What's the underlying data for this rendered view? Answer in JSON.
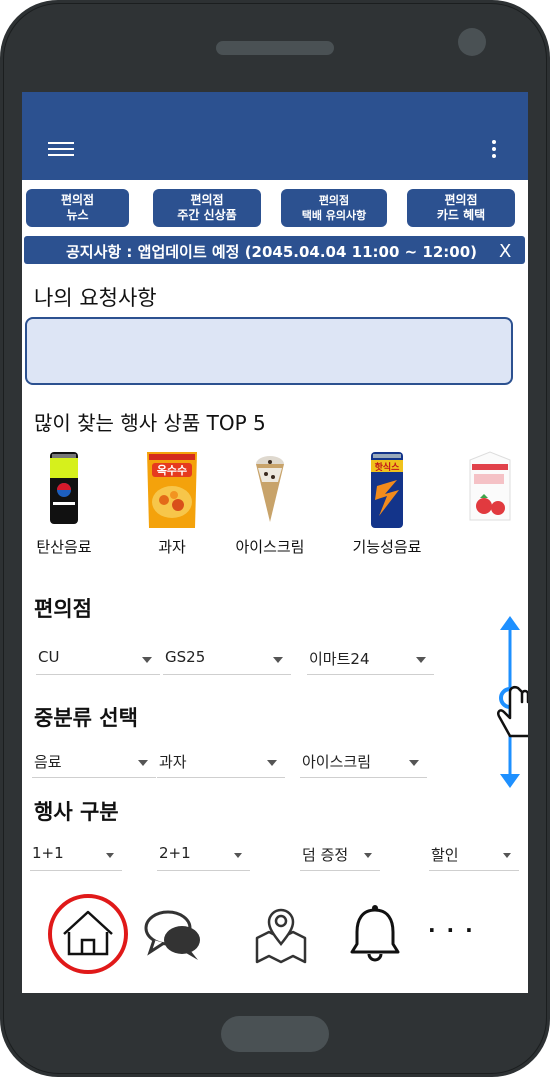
{
  "tabs": [
    {
      "line1": "편의점",
      "line2": "뉴스"
    },
    {
      "line1": "편의점",
      "line2": "주간 신상품"
    },
    {
      "line1": "편의점",
      "line2": "택배 유의사항"
    },
    {
      "line1": "편의점",
      "line2": "카드 혜택"
    }
  ],
  "notice": {
    "text": "공지사항 : 앱업데이트 예정 (2045.04.04 11:00 ~ 12:00)",
    "close": "X"
  },
  "request": {
    "title": "나의 요청사항",
    "value": ""
  },
  "top5": {
    "title": "많이 찾는 행사 상품 TOP 5",
    "items": [
      {
        "label": "탄산음료",
        "icon": "cola-can-icon"
      },
      {
        "label": "과자",
        "icon": "snack-bag-icon"
      },
      {
        "label": "아이스크림",
        "icon": "ice-cream-cone-icon"
      },
      {
        "label": "기능성음료",
        "icon": "energy-drink-can-icon"
      },
      {
        "label": "",
        "icon": "milk-carton-icon"
      }
    ]
  },
  "store": {
    "title": "편의점",
    "options": [
      "CU",
      "GS25",
      "이마트24"
    ]
  },
  "category": {
    "title": "중분류 선택",
    "options": [
      "음료",
      "과자",
      "아이스크림"
    ]
  },
  "event": {
    "title": "행사 구분",
    "options": [
      "1+1",
      "2+1",
      "덤 증정",
      "할인"
    ]
  },
  "bottom_nav": {
    "home": "home-icon",
    "chat": "chat-bubbles-icon",
    "map": "map-pin-icon",
    "alarm": "bell-icon",
    "more": "· · ·"
  },
  "colors": {
    "primary": "#2c5190",
    "request_fill": "#dde5f5",
    "scroll_hint": "#1e90ff",
    "home_ring": "#e01919"
  }
}
